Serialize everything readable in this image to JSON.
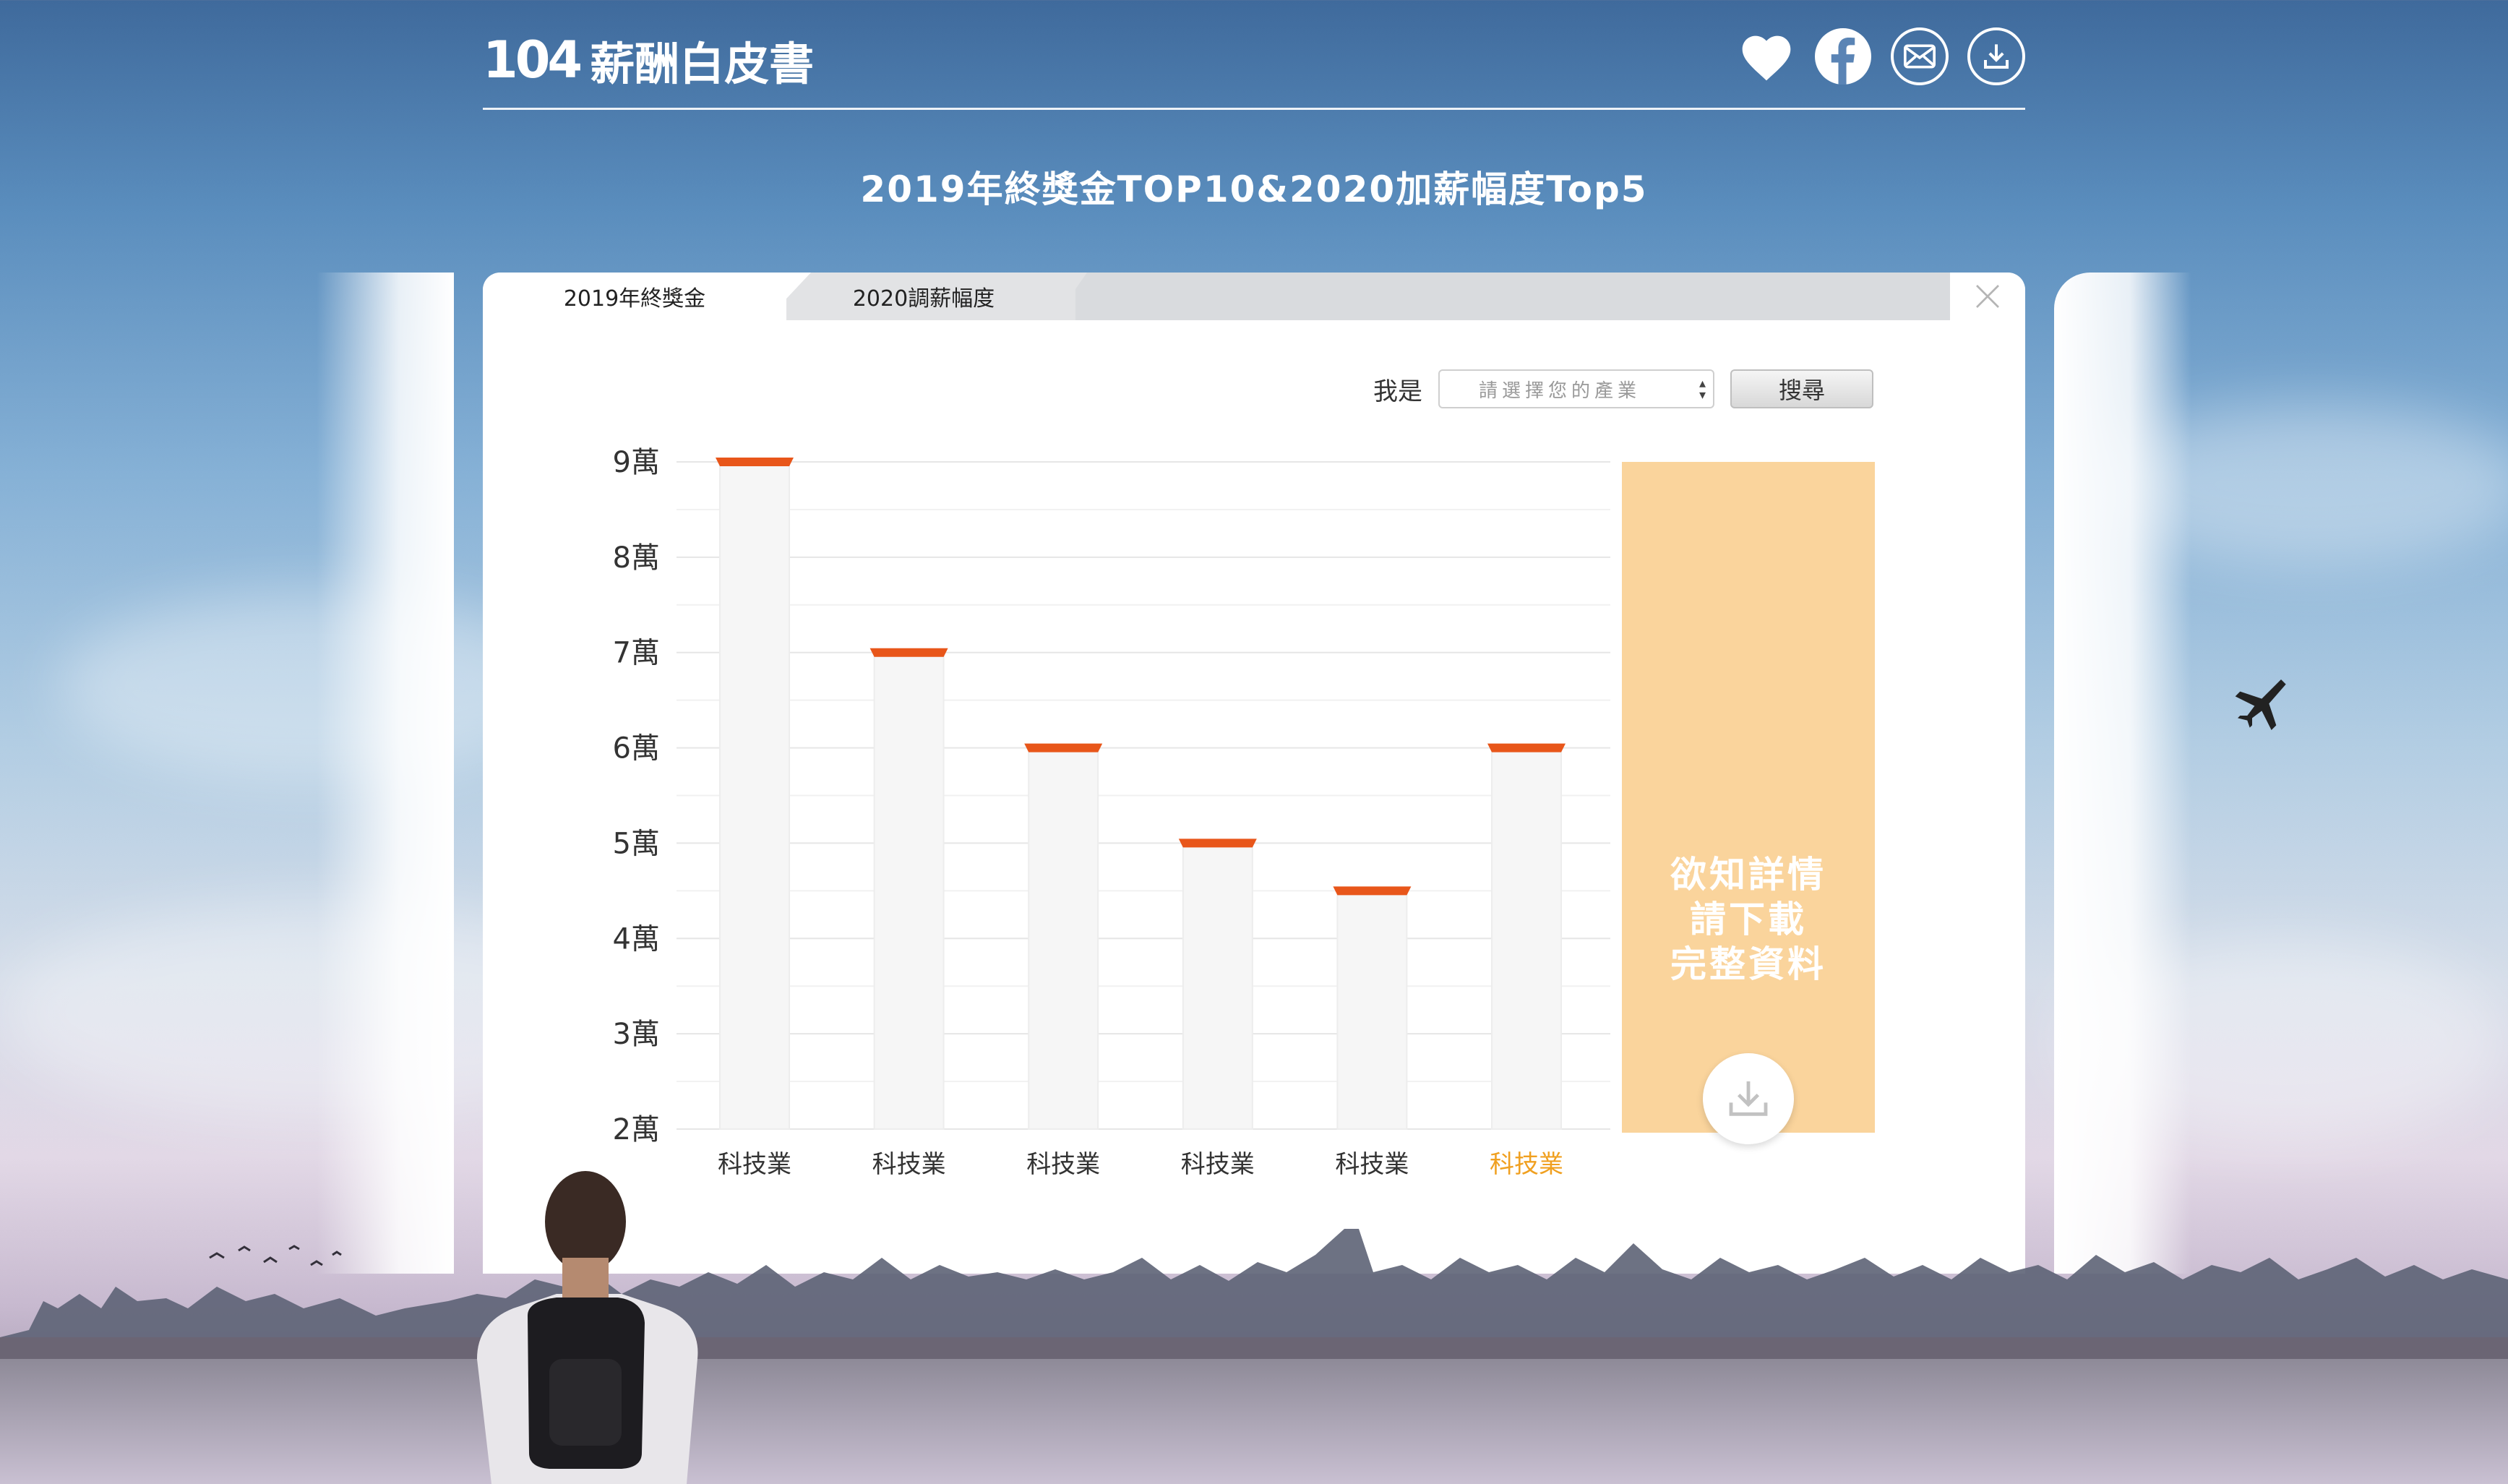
{
  "header": {
    "logo_mark": "104",
    "logo_text": "薪酬白皮書",
    "icons": [
      "heart-icon",
      "facebook-icon",
      "mail-icon",
      "download-icon"
    ]
  },
  "page_title": "2019年終獎金TOP10&2020加薪幅度Top5",
  "tabs": [
    {
      "label": "2019年終獎金",
      "active": true
    },
    {
      "label": "2020調薪幅度",
      "active": false
    }
  ],
  "filter": {
    "label": "我是",
    "placeholder": "請選擇您的產業",
    "search_label": "搜尋"
  },
  "cta": {
    "line1": "欲知詳情",
    "line2": "請下載",
    "line3": "完整資料"
  },
  "colors": {
    "accent_orange": "#e8561a",
    "highlight_label": "#f0a020",
    "cta_bg": "#fad49c",
    "bar_fill": "#f6f6f6"
  },
  "chart_data": {
    "type": "bar",
    "title": "",
    "xlabel": "",
    "ylabel": "",
    "y_ticks": [
      "2萬",
      "3萬",
      "4萬",
      "5萬",
      "6萬",
      "7萬",
      "8萬",
      "9萬"
    ],
    "ylim": [
      2,
      9
    ],
    "categories": [
      "科技業",
      "科技業",
      "科技業",
      "科技業",
      "科技業",
      "科技業"
    ],
    "values": [
      9,
      7,
      6,
      5,
      4.5,
      6
    ],
    "highlight_index": 5,
    "grid": true
  }
}
